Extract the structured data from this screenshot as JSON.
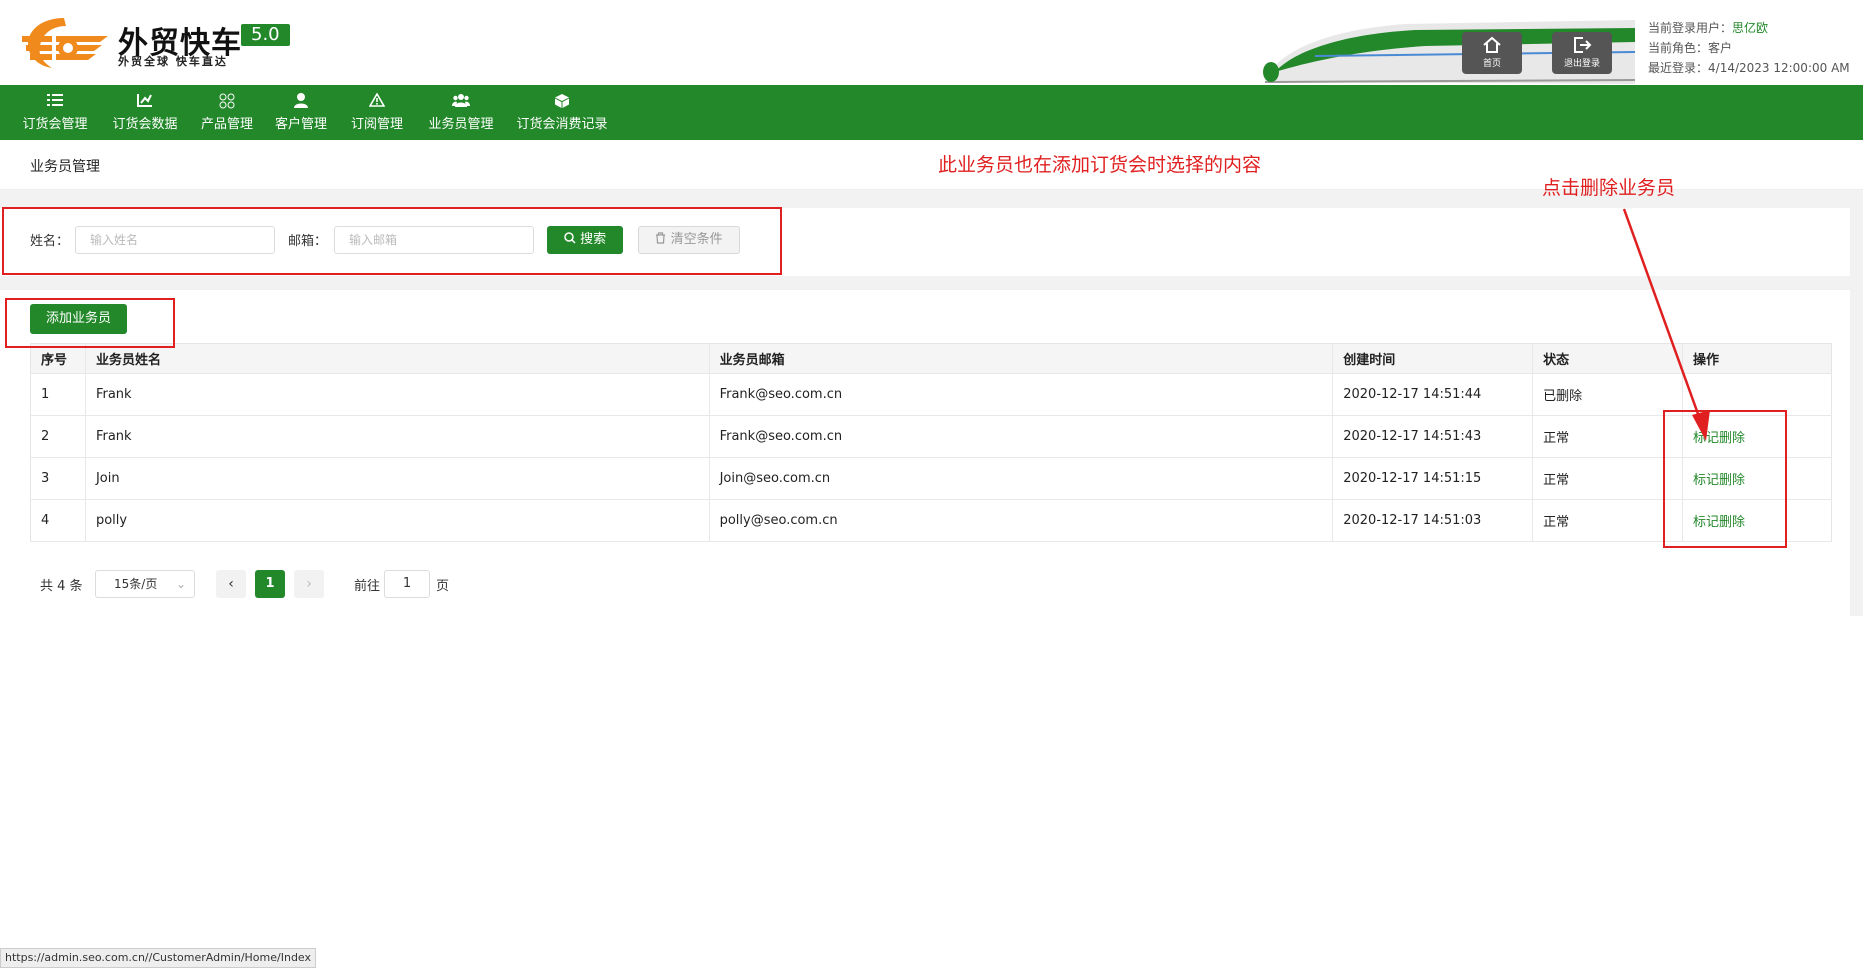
{
  "header": {
    "brand_name": "外贸快车",
    "version": "5.0",
    "slogan": "外贸全球 快车直达",
    "home_label": "首页",
    "logout_label": "退出登录",
    "user_label": "当前登录用户：",
    "user_name": "思亿欧",
    "role_label": "当前角色：",
    "role_value": "客户",
    "last_login_label": "最近登录：",
    "last_login_value": "4/14/2023 12:00:00 AM"
  },
  "nav": {
    "items": [
      {
        "label": "订货会管理",
        "icon": "list-icon"
      },
      {
        "label": "订货会数据",
        "icon": "chart-icon"
      },
      {
        "label": "产品管理",
        "icon": "grid-icon"
      },
      {
        "label": "客户管理",
        "icon": "user-icon"
      },
      {
        "label": "订阅管理",
        "icon": "warning-icon"
      },
      {
        "label": "业务员管理",
        "icon": "users-icon"
      },
      {
        "label": "订货会消费记录",
        "icon": "box-icon"
      }
    ]
  },
  "page": {
    "title": "业务员管理"
  },
  "search": {
    "name_label": "姓名：",
    "name_placeholder": "输入姓名",
    "email_label": "邮箱：",
    "email_placeholder": "输入邮箱",
    "search_button": "搜索",
    "clear_button": "清空条件"
  },
  "list": {
    "add_button": "添加业务员",
    "columns": [
      "序号",
      "业务员姓名",
      "业务员邮箱",
      "创建时间",
      "状态",
      "操作"
    ],
    "rows": [
      {
        "no": "1",
        "name": "Frank",
        "email": "Frank@seo.com.cn",
        "created": "2020-12-17 14:51:44",
        "status": "已删除",
        "action": ""
      },
      {
        "no": "2",
        "name": "Frank",
        "email": "Frank@seo.com.cn",
        "created": "2020-12-17 14:51:43",
        "status": "正常",
        "action": "标记删除"
      },
      {
        "no": "3",
        "name": "Join",
        "email": "Join@seo.com.cn",
        "created": "2020-12-17 14:51:15",
        "status": "正常",
        "action": "标记删除"
      },
      {
        "no": "4",
        "name": "polly",
        "email": "polly@seo.com.cn",
        "created": "2020-12-17 14:51:03",
        "status": "正常",
        "action": "标记删除"
      }
    ]
  },
  "pagination": {
    "total": "共 4 条",
    "page_size": "15条/页",
    "current": "1",
    "goto_label": "前往",
    "goto_value": "1",
    "page_unit": "页"
  },
  "annotations": {
    "note_top": "此业务员也在添加订货会时选择的内容",
    "note_delete": "点击删除业务员"
  },
  "status_bar": {
    "url": "https://admin.seo.com.cn//CustomerAdmin/Home/Index"
  },
  "colors": {
    "brand_green": "#23882a",
    "annotation_red": "#e02020",
    "logo_orange": "#f08a1c"
  }
}
